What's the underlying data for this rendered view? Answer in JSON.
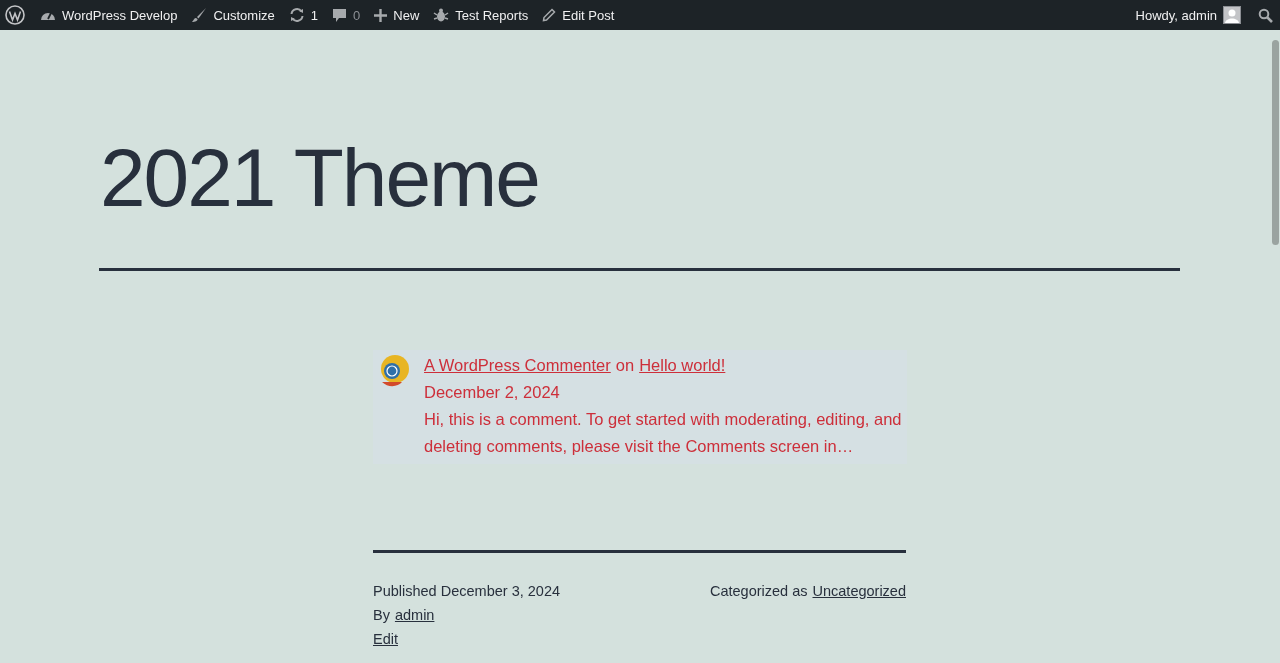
{
  "admin_bar": {
    "left": [
      {
        "kind": "wp-logo"
      },
      {
        "kind": "dashboard",
        "label": "WordPress Develop"
      },
      {
        "kind": "brush",
        "label": "Customize"
      },
      {
        "kind": "updates",
        "label": "1"
      },
      {
        "kind": "comments",
        "label": "0"
      },
      {
        "kind": "new",
        "label": "New"
      },
      {
        "kind": "bug",
        "label": "Test Reports"
      },
      {
        "kind": "pencil",
        "label": "Edit Post"
      }
    ],
    "greeting": "Howdy, admin"
  },
  "site_title": "2021 Theme",
  "comment": {
    "author": "A WordPress Commenter",
    "connector": "on",
    "post": "Hello world!",
    "date": "December 2, 2024",
    "excerpt": "Hi, this is a comment. To get started with moderating, editing, and deleting comments, please visit the Comments screen in…"
  },
  "meta": {
    "published": "Published December 3, 2024",
    "by_label": "By",
    "author": "admin",
    "edit": "Edit",
    "category_label": "Categorized as",
    "category": "Uncategorized"
  }
}
